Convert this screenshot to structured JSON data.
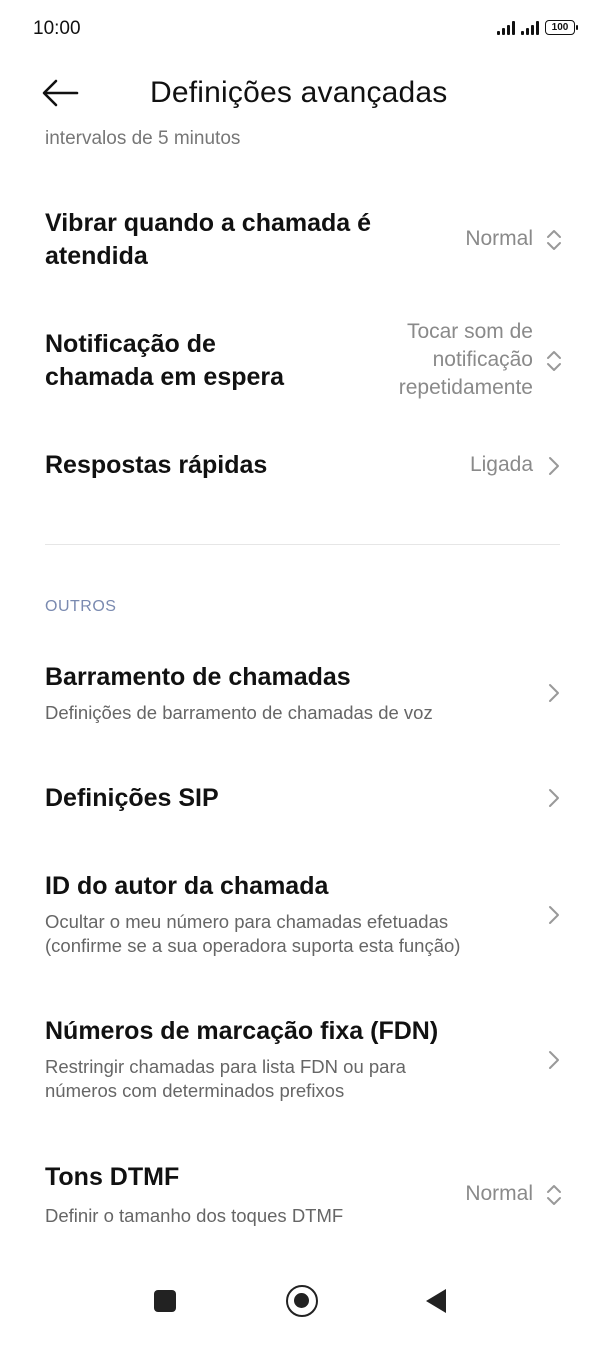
{
  "status_bar": {
    "time": "10:00",
    "battery": "100"
  },
  "header": {
    "title": "Definições avançadas"
  },
  "clipped_text": "intervalos de 5 minutos",
  "rows_top": [
    {
      "title_lines": [
        "Vibrar quando a chamada é",
        "atendida"
      ],
      "value_lines": [
        "Normal"
      ],
      "control": "updown"
    },
    {
      "title_lines": [
        "Notificação de",
        "chamada em espera"
      ],
      "value_lines": [
        "Tocar som de",
        "notificação",
        "repetidamente"
      ],
      "control": "updown"
    },
    {
      "title_lines": [
        "Respostas rápidas"
      ],
      "value_lines": [
        "Ligada"
      ],
      "control": "chevron"
    }
  ],
  "section": {
    "label": "OUTROS"
  },
  "rows_others": [
    {
      "title": "Barramento de chamadas",
      "sub_lines": [
        "Definições de barramento de chamadas de voz"
      ],
      "control": "chevron"
    },
    {
      "title": "Definições SIP",
      "sub_lines": [],
      "control": "chevron"
    },
    {
      "title": "ID do autor da chamada",
      "sub_lines": [
        "Ocultar o meu número para chamadas efetuadas",
        "(confirme se a sua operadora suporta esta função)"
      ],
      "control": "chevron"
    },
    {
      "title": "Números de marcação fixa (FDN)",
      "sub_lines": [
        "Restringir chamadas para lista FDN ou para",
        "números com determinados prefixos"
      ],
      "control": "chevron"
    },
    {
      "title": "Tons DTMF",
      "sub_lines": [
        "Definir o tamanho dos toques DTMF"
      ],
      "value": "Normal",
      "control": "updown"
    }
  ],
  "colors": {
    "accent_section": "#7a8ab0",
    "value_gray": "#8a8a8a"
  }
}
